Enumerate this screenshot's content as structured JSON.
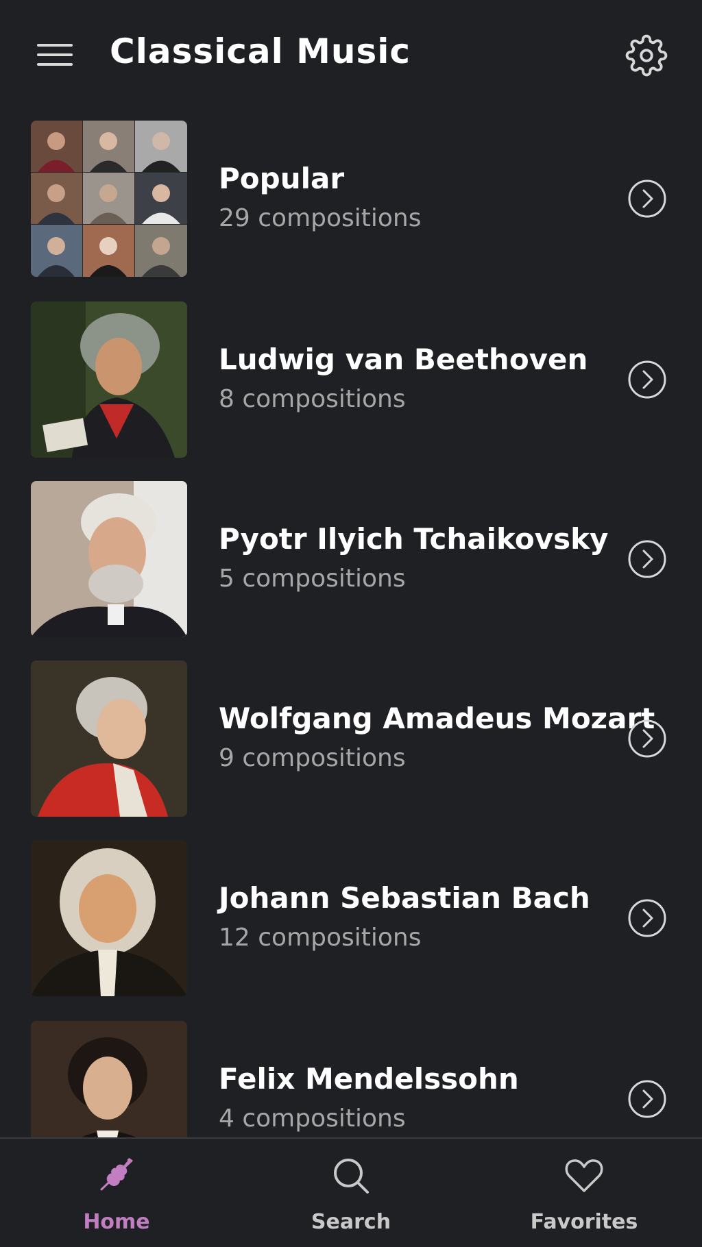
{
  "header": {
    "title": "Classical Music",
    "menu_icon": "hamburger-menu-icon",
    "settings_icon": "gear-icon"
  },
  "composers": [
    {
      "name": "Popular",
      "count": "29 compositions"
    },
    {
      "name": "Ludwig van Beethoven",
      "count": "8 compositions"
    },
    {
      "name": "Pyotr Ilyich Tchaikovsky",
      "count": "5 compositions"
    },
    {
      "name": "Wolfgang Amadeus Mozart",
      "count": "9 compositions"
    },
    {
      "name": "Johann Sebastian Bach",
      "count": "12 compositions"
    },
    {
      "name": "Felix Mendelssohn",
      "count": "4 compositions"
    }
  ],
  "bottom_nav": {
    "items": [
      {
        "label": "Home",
        "icon": "violin-icon",
        "active": true
      },
      {
        "label": "Search",
        "icon": "search-icon",
        "active": false
      },
      {
        "label": "Favorites",
        "icon": "heart-icon",
        "active": false
      }
    ]
  },
  "colors": {
    "background": "#1f2024",
    "accent": "#c17fc2",
    "secondary_text": "#a7a7a7"
  }
}
